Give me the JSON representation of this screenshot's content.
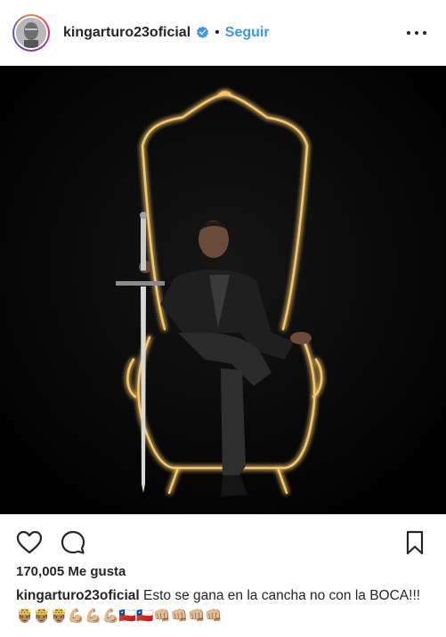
{
  "header": {
    "username": "kingarturo23oficial",
    "verified_icon": "verified-badge-icon",
    "separator": "•",
    "follow_label": "Seguir",
    "more_icon": "more-options-icon"
  },
  "photo": {
    "alt": "photo"
  },
  "actions": {
    "like_icon": "heart-icon",
    "comment_icon": "comment-icon",
    "save_icon": "bookmark-icon"
  },
  "likes": {
    "text": "170,005 Me gusta"
  },
  "caption": {
    "username": "kingarturo23oficial",
    "text": "Esto se gana en la cancha no con la BOCA!!! 🤴🏽🤴🏽🤴🏽💪🏼💪🏼💪🏼🇨🇱🇨🇱👊🏼👊🏼👊🏼👊🏼"
  },
  "colors": {
    "link": "#3897f0",
    "text": "#262626",
    "verified": "#3897f0"
  }
}
